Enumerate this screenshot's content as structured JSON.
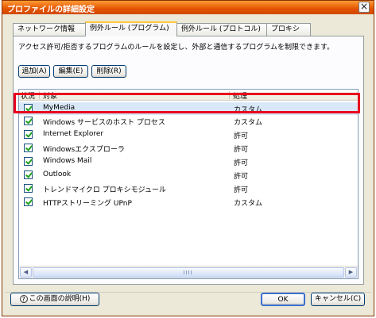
{
  "window": {
    "title": "プロファイルの詳細設定",
    "close_glyph": "×"
  },
  "tabs": [
    {
      "label": "ネットワーク情報",
      "active": false
    },
    {
      "label": "例外ルール (プログラム)",
      "active": true
    },
    {
      "label": "例外ルール (プロトコル)",
      "active": false
    },
    {
      "label": "プロキシ",
      "active": false
    }
  ],
  "description": "アクセス許可/拒否するプログラムのルールを設定し、外部と通信するプログラムを制限できます。",
  "toolbar": {
    "add_label": "追加(A)",
    "edit_label": "編集(E)",
    "delete_label": "削除(R)"
  },
  "list": {
    "columns": {
      "status": "状況",
      "target": "対象",
      "action": "処理"
    },
    "rows": [
      {
        "checked": true,
        "target": "MyMedia",
        "action": "カスタム",
        "selected": true
      },
      {
        "checked": true,
        "target": "Windows サービスのホスト プロセス",
        "action": "カスタム"
      },
      {
        "checked": true,
        "target": "Internet Explorer",
        "action": "許可"
      },
      {
        "checked": true,
        "target": "Windowsエクスプローラ",
        "action": "許可"
      },
      {
        "checked": true,
        "target": "Windows Mail",
        "action": "許可"
      },
      {
        "checked": true,
        "target": "Outlook",
        "action": "許可"
      },
      {
        "checked": true,
        "target": "トレンドマイクロ プロキシモジュール",
        "action": "許可"
      },
      {
        "checked": true,
        "target": "HTTPストリーミング UPnP",
        "action": "カスタム"
      }
    ]
  },
  "footer": {
    "help_label": "この画面の説明(H)",
    "help_icon": "?",
    "ok_label": "OK",
    "cancel_label": "キャンセル(C)"
  },
  "colors": {
    "title_bar": "#e35300",
    "highlight_frame": "#e8001c",
    "selected_row": "#d9e8f8",
    "check_mark": "#21a121"
  }
}
